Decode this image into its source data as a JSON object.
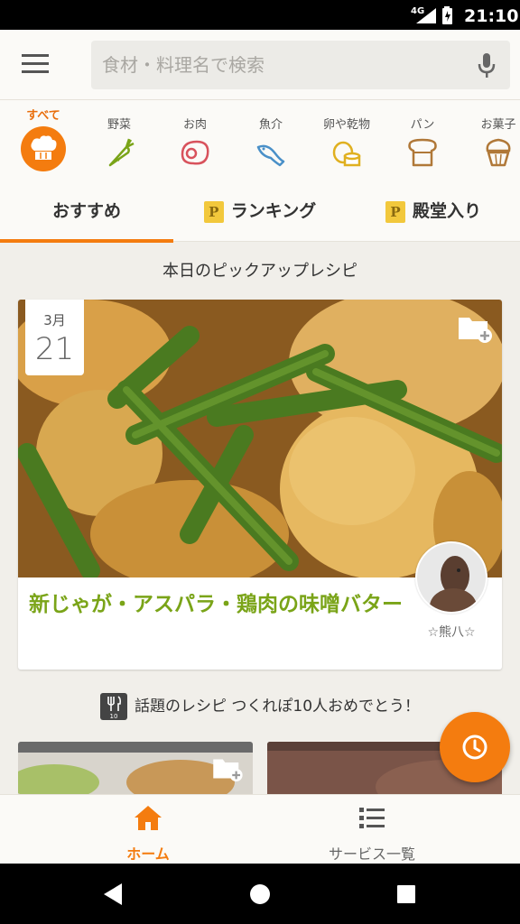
{
  "status_bar": {
    "network": "4G",
    "time": "21:10"
  },
  "header": {
    "search_placeholder": "食材・料理名で検索"
  },
  "categories": [
    {
      "label": "すべて",
      "icon": "chef-hat-icon",
      "active": true
    },
    {
      "label": "野菜",
      "icon": "carrot-icon"
    },
    {
      "label": "お肉",
      "icon": "meat-icon"
    },
    {
      "label": "魚介",
      "icon": "fish-icon"
    },
    {
      "label": "卵や乾物",
      "icon": "egg-icon"
    },
    {
      "label": "パン",
      "icon": "bread-icon"
    },
    {
      "label": "お菓子",
      "icon": "cupcake-icon"
    }
  ],
  "tabs": [
    {
      "label": "おすすめ",
      "active": true
    },
    {
      "label": "ランキング",
      "badge": "P"
    },
    {
      "label": "殿堂入り",
      "badge": "P"
    }
  ],
  "pickup": {
    "section_title": "本日のピックアップレシピ",
    "month": "3月",
    "day": "21",
    "recipe_title": "新じゃが・アスパラ・鶏肉の味噌バター",
    "author": "☆熊八☆"
  },
  "topic": {
    "badge_number": "10",
    "text": "話題のレシピ つくれぽ10人おめでとう！"
  },
  "bottom_nav": [
    {
      "label": "ホーム",
      "icon": "home-icon",
      "active": true
    },
    {
      "label": "サービス一覧",
      "icon": "list-icon"
    }
  ],
  "colors": {
    "accent": "#f47c0f",
    "recipe_title": "#7aa418",
    "badge_gold": "#f2c83c"
  }
}
